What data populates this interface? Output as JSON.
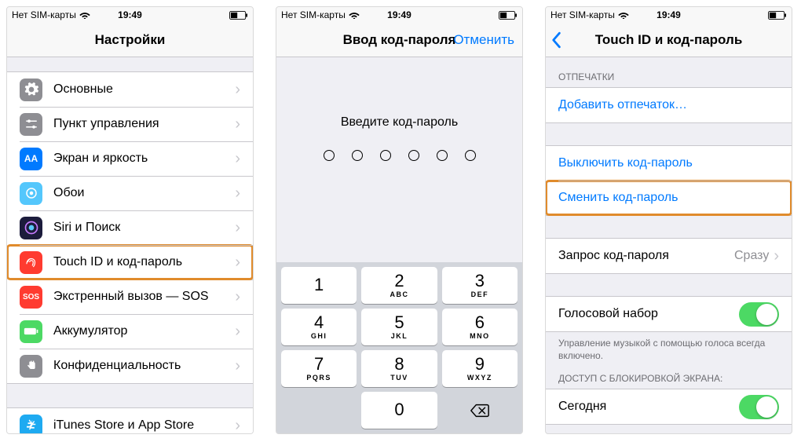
{
  "status": {
    "carrier": "Нет SIM-карты",
    "time": "19:49"
  },
  "screen1": {
    "title": "Настройки",
    "items": [
      {
        "label": "Основные",
        "icon": "gear-icon",
        "cls": "ic-general"
      },
      {
        "label": "Пункт управления",
        "icon": "sliders-icon",
        "cls": "ic-control"
      },
      {
        "label": "Экран и яркость",
        "icon": "display-icon",
        "cls": "ic-display"
      },
      {
        "label": "Обои",
        "icon": "wallpaper-icon",
        "cls": "ic-wallpaper"
      },
      {
        "label": "Siri и Поиск",
        "icon": "siri-icon",
        "cls": "ic-siri"
      },
      {
        "label": "Touch ID и код-пароль",
        "icon": "fingerprint-icon",
        "cls": "ic-touchid",
        "highlight": true
      },
      {
        "label": "Экстренный вызов — SOS",
        "icon": "sos-icon",
        "cls": "ic-sos"
      },
      {
        "label": "Аккумулятор",
        "icon": "battery-icon",
        "cls": "ic-battery"
      },
      {
        "label": "Конфиденциальность",
        "icon": "hand-icon",
        "cls": "ic-privacy"
      }
    ],
    "items2": [
      {
        "label": "iTunes Store и App Store",
        "icon": "appstore-icon",
        "cls": "ic-itunes"
      }
    ]
  },
  "screen2": {
    "title": "Ввод код-пароля",
    "cancel": "Отменить",
    "prompt": "Введите код-пароль",
    "keypad": [
      {
        "n": "1",
        "l": ""
      },
      {
        "n": "2",
        "l": "ABC"
      },
      {
        "n": "3",
        "l": "DEF"
      },
      {
        "n": "4",
        "l": "GHI"
      },
      {
        "n": "5",
        "l": "JKL"
      },
      {
        "n": "6",
        "l": "MNO"
      },
      {
        "n": "7",
        "l": "PQRS"
      },
      {
        "n": "8",
        "l": "TUV"
      },
      {
        "n": "9",
        "l": "WXYZ"
      },
      {
        "n": "0",
        "l": ""
      }
    ]
  },
  "screen3": {
    "title": "Touch ID и код-пароль",
    "section_fingerprints": "ОТПЕЧАТКИ",
    "add_fingerprint": "Добавить отпечаток…",
    "turn_off": "Выключить код-пароль",
    "change": "Сменить код-пароль",
    "require_label": "Запрос код-пароля",
    "require_value": "Сразу",
    "voice_label": "Голосовой набор",
    "voice_footer": "Управление музыкой с помощью голоса всегда включено.",
    "lock_header": "ДОСТУП С БЛОКИРОВКОЙ ЭКРАНА:",
    "today": "Сегодня"
  }
}
